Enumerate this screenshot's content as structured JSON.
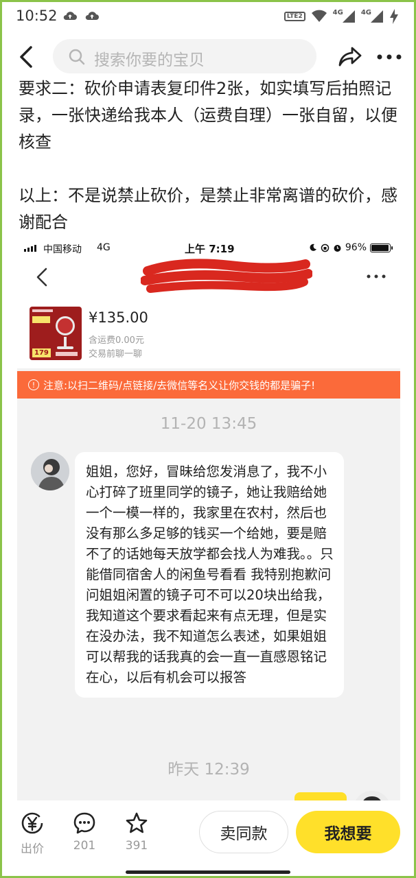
{
  "status_bar": {
    "time": "10:52",
    "lte_badge": "LTE2",
    "net1": "4G",
    "net2": "4G"
  },
  "nav": {
    "search_placeholder": "搜索你要的宝贝"
  },
  "description": {
    "line1": "要求二：砍价申请表复印件2张，如实填写后拍照记录，一张快递给我本人（运费自理）一张自留，以便核查",
    "line2": "以上：不是说禁止砍价，是禁止非常离谱的砍价，感谢配合"
  },
  "screenshot": {
    "ios_status": {
      "carrier": "中国移动",
      "network": "4G",
      "time": "上午 7:19",
      "battery": "96%"
    },
    "product": {
      "thumb_price": "179",
      "price": "¥135.00",
      "shipping": "含运费0.00元",
      "chat_hint": "交易前聊一聊"
    },
    "warning": "注意:以扫二维码/点链接/去微信等名义让你交钱的都是骗子!",
    "timestamp1": "11-20 13:45",
    "message": "姐姐，您好，冒昧给您发消息了，我不小心打碎了班里同学的镜子，她让我赔给她一个一模一样的，我家里在农村，然后也没有那么多足够的钱买一个给她，要是赔不了的话她每天放学都会找人为难我。。只能借同宿舍人的闲鱼号看看 我特别抱歉问问姐姐闲置的镜子可不可以20块出给我，我知道这个要求看起来有点无理，但是实在没办法，我不知道怎么表述，如果姐姐可以帮我的话我真的会一直一直感恩铭记在心，以后有机会可以报答",
    "timestamp2": "昨天 12:39"
  },
  "bottom_bar": {
    "offer_label": "出价",
    "comments_count": "201",
    "favorites_count": "391",
    "same_item_label": "卖同款",
    "want_label": "我想要"
  },
  "colors": {
    "accent_yellow": "#ffe02a",
    "warning_orange": "#fb6a3a",
    "frame_green": "#8bc34a"
  }
}
